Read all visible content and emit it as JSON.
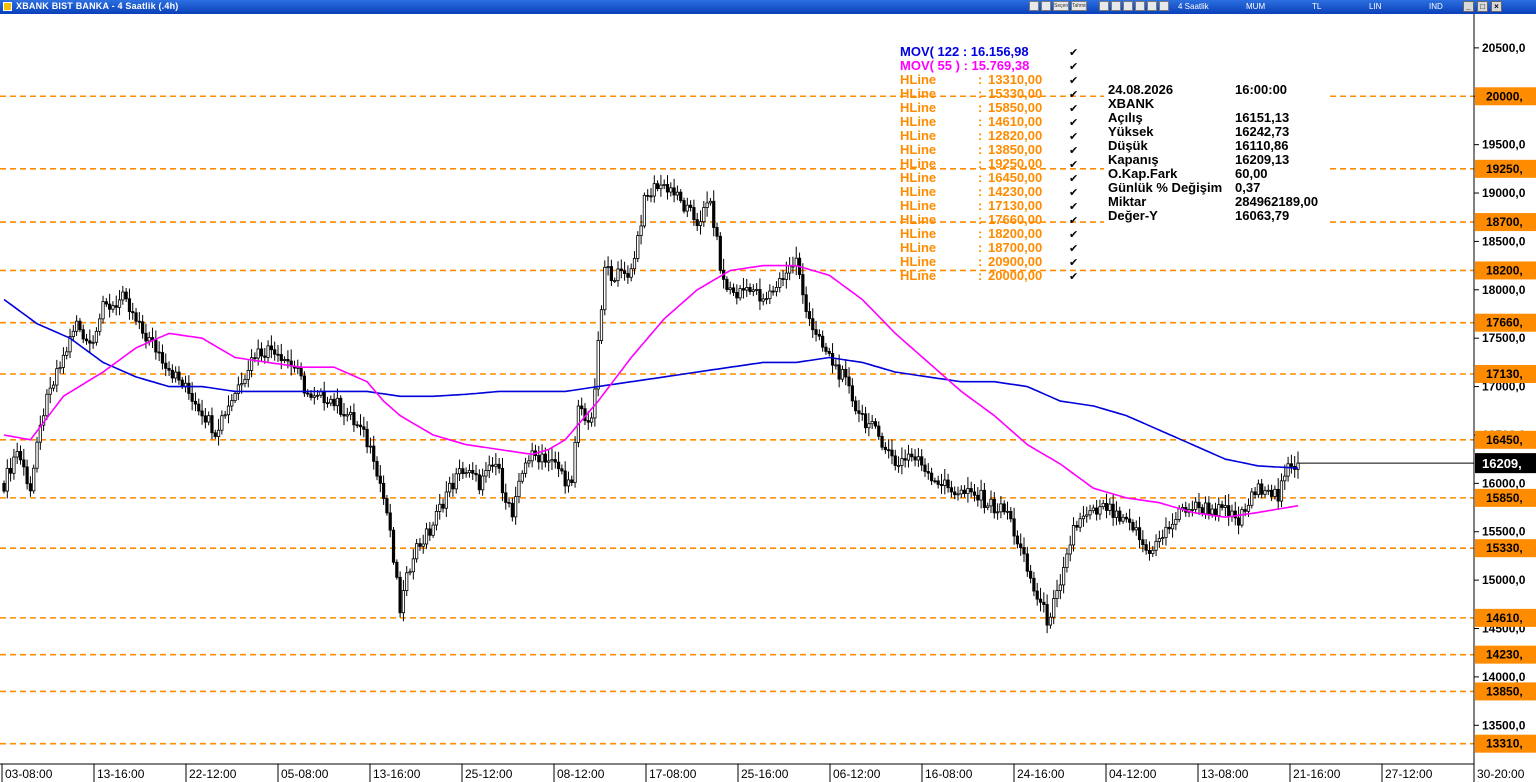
{
  "window": {
    "title": "XBANK BIST BANKA - 4 Saatlik (.4h)",
    "toolbar": [
      "4 Saatlik",
      "MUM",
      "TL",
      "LIN",
      "IND"
    ],
    "toolbar_small_labels": [
      "Seçenekler",
      "Tahmin"
    ],
    "window_buttons": [
      "_",
      "□",
      "×"
    ]
  },
  "legend": {
    "mov122": {
      "label": "MOV( 122 : 16.156,98",
      "color": "#0000e0"
    },
    "mov55": {
      "label": "MOV( 55 ) : 15.769,38",
      "color": "#ff00ff"
    },
    "hline_label": "HLine",
    "hline_values": [
      "13310,00",
      "15330,00",
      "15850,00",
      "14610,00",
      "12820,00",
      "13850,00",
      "19250,00",
      "16450,00",
      "14230,00",
      "17130,00",
      "17660,00",
      "18200,00",
      "18700,00",
      "20900,00",
      "20000,00"
    ],
    "check": "✔"
  },
  "info_box": {
    "date": "24.08.2026",
    "time": "16:00:00",
    "symbol": "XBANK",
    "rows": [
      {
        "label": "Açılış",
        "value": "16151,13"
      },
      {
        "label": "Yüksek",
        "value": "16242,73"
      },
      {
        "label": "Düşük",
        "value": "16110,86"
      },
      {
        "label": "Kapanış",
        "value": "16209,13"
      },
      {
        "label": "O.Kap.Fark",
        "value": "60,00"
      },
      {
        "label": "Günlük % Değişim",
        "value": "0,37"
      },
      {
        "label": "Miktar",
        "value": "284962189,00"
      },
      {
        "label": "Değer-Y",
        "value": "16063,79"
      }
    ]
  },
  "chart_data": {
    "type": "candlestick",
    "symbol": "XBANK",
    "ylim": [
      13100,
      20850
    ],
    "y_ticks": [
      "20500,0",
      "20000,",
      "19500,0",
      "19000,0",
      "18500,0",
      "18000,0",
      "17500,0",
      "17000,0",
      "16500,0",
      "16000,0",
      "15500,0",
      "15000,0",
      "14500,0",
      "14000,0",
      "13500,0"
    ],
    "y_tick_values": [
      20500,
      20000,
      19500,
      19000,
      18500,
      18000,
      17500,
      17000,
      16500,
      16000,
      15500,
      15000,
      14500,
      14000,
      13500
    ],
    "hlines": [
      {
        "value": 20000,
        "label": "20000,"
      },
      {
        "value": 19250,
        "label": "19250,"
      },
      {
        "value": 18700,
        "label": "18700,"
      },
      {
        "value": 18200,
        "label": "18200,"
      },
      {
        "value": 17660,
        "label": "17660,"
      },
      {
        "value": 17130,
        "label": "17130,"
      },
      {
        "value": 16450,
        "label": "16450,"
      },
      {
        "value": 15850,
        "label": "15850,"
      },
      {
        "value": 15330,
        "label": "15330,"
      },
      {
        "value": 14610,
        "label": "14610,"
      },
      {
        "value": 14230,
        "label": "14230,"
      },
      {
        "value": 13850,
        "label": "13850,"
      },
      {
        "value": 13310,
        "label": "13310,"
      }
    ],
    "last_price": {
      "value": 16209,
      "label": "16209,"
    },
    "x_tick_labels": [
      "03-08:00",
      "13-16:00",
      "22-12:00",
      "05-08:00",
      "13-16:00",
      "25-12:00",
      "08-12:00",
      "17-08:00",
      "25-16:00",
      "06-12:00",
      "16-08:00",
      "24-16:00",
      "04-12:00",
      "13-08:00",
      "21-16:00",
      "27-12:00",
      "30-20:00"
    ],
    "close_anchors": [
      [
        0,
        16000
      ],
      [
        4,
        16350
      ],
      [
        8,
        15950
      ],
      [
        12,
        16750
      ],
      [
        18,
        17300
      ],
      [
        22,
        17650
      ],
      [
        26,
        17450
      ],
      [
        30,
        17800
      ],
      [
        36,
        17900
      ],
      [
        41,
        17600
      ],
      [
        47,
        17350
      ],
      [
        52,
        17100
      ],
      [
        58,
        16850
      ],
      [
        64,
        16550
      ],
      [
        70,
        16950
      ],
      [
        76,
        17350
      ],
      [
        82,
        17400
      ],
      [
        88,
        17200
      ],
      [
        93,
        16850
      ],
      [
        98,
        16900
      ],
      [
        103,
        16750
      ],
      [
        108,
        16550
      ],
      [
        112,
        16300
      ],
      [
        116,
        15700
      ],
      [
        120,
        14700
      ],
      [
        124,
        15300
      ],
      [
        129,
        15500
      ],
      [
        134,
        15900
      ],
      [
        139,
        16150
      ],
      [
        144,
        16000
      ],
      [
        149,
        16200
      ],
      [
        154,
        15650
      ],
      [
        158,
        16250
      ],
      [
        163,
        16300
      ],
      [
        168,
        16150
      ],
      [
        172,
        15950
      ],
      [
        174,
        16800
      ],
      [
        178,
        16600
      ],
      [
        182,
        18200
      ],
      [
        186,
        18150
      ],
      [
        190,
        18200
      ],
      [
        194,
        18900
      ],
      [
        198,
        19100
      ],
      [
        202,
        19050
      ],
      [
        206,
        18850
      ],
      [
        210,
        18700
      ],
      [
        214,
        18900
      ],
      [
        218,
        18050
      ],
      [
        222,
        17950
      ],
      [
        226,
        18050
      ],
      [
        230,
        17850
      ],
      [
        236,
        18150
      ],
      [
        240,
        18300
      ],
      [
        242,
        17950
      ],
      [
        246,
        17500
      ],
      [
        250,
        17300
      ],
      [
        254,
        17100
      ],
      [
        258,
        16800
      ],
      [
        262,
        16600
      ],
      [
        266,
        16450
      ],
      [
        270,
        16200
      ],
      [
        274,
        16300
      ],
      [
        278,
        16200
      ],
      [
        282,
        16050
      ],
      [
        286,
        15950
      ],
      [
        290,
        15900
      ],
      [
        296,
        15850
      ],
      [
        300,
        15750
      ],
      [
        304,
        15700
      ],
      [
        308,
        15300
      ],
      [
        312,
        14900
      ],
      [
        316,
        14600
      ],
      [
        320,
        14900
      ],
      [
        324,
        15550
      ],
      [
        328,
        15650
      ],
      [
        334,
        15750
      ],
      [
        338,
        15600
      ],
      [
        342,
        15550
      ],
      [
        346,
        15300
      ],
      [
        350,
        15400
      ],
      [
        354,
        15600
      ],
      [
        358,
        15750
      ],
      [
        364,
        15750
      ],
      [
        370,
        15700
      ],
      [
        374,
        15600
      ],
      [
        378,
        15850
      ],
      [
        382,
        16000
      ],
      [
        386,
        15850
      ],
      [
        389,
        16150
      ],
      [
        392,
        16209
      ]
    ],
    "mov122": {
      "name": "MOV( 122",
      "last": 16156.98,
      "anchors": [
        [
          0,
          17900
        ],
        [
          10,
          17650
        ],
        [
          20,
          17500
        ],
        [
          30,
          17250
        ],
        [
          40,
          17100
        ],
        [
          50,
          17000
        ],
        [
          60,
          17000
        ],
        [
          70,
          16950
        ],
        [
          80,
          16950
        ],
        [
          90,
          16950
        ],
        [
          100,
          16950
        ],
        [
          110,
          16950
        ],
        [
          120,
          16900
        ],
        [
          130,
          16900
        ],
        [
          140,
          16920
        ],
        [
          150,
          16950
        ],
        [
          160,
          16950
        ],
        [
          170,
          16950
        ],
        [
          180,
          17000
        ],
        [
          190,
          17050
        ],
        [
          200,
          17100
        ],
        [
          210,
          17150
        ],
        [
          220,
          17200
        ],
        [
          230,
          17250
        ],
        [
          240,
          17250
        ],
        [
          250,
          17300
        ],
        [
          260,
          17250
        ],
        [
          270,
          17150
        ],
        [
          280,
          17100
        ],
        [
          290,
          17050
        ],
        [
          300,
          17050
        ],
        [
          310,
          17000
        ],
        [
          320,
          16850
        ],
        [
          330,
          16800
        ],
        [
          340,
          16700
        ],
        [
          350,
          16550
        ],
        [
          360,
          16400
        ],
        [
          370,
          16250
        ],
        [
          380,
          16180
        ],
        [
          392,
          16157
        ]
      ]
    },
    "mov55": {
      "name": "MOV( 55 )",
      "last": 15769.38,
      "anchors": [
        [
          0,
          16500
        ],
        [
          8,
          16450
        ],
        [
          18,
          16900
        ],
        [
          30,
          17150
        ],
        [
          40,
          17400
        ],
        [
          50,
          17550
        ],
        [
          60,
          17500
        ],
        [
          70,
          17300
        ],
        [
          80,
          17250
        ],
        [
          90,
          17200
        ],
        [
          100,
          17200
        ],
        [
          110,
          17050
        ],
        [
          115,
          16850
        ],
        [
          120,
          16700
        ],
        [
          130,
          16500
        ],
        [
          140,
          16400
        ],
        [
          150,
          16350
        ],
        [
          160,
          16300
        ],
        [
          165,
          16350
        ],
        [
          170,
          16450
        ],
        [
          180,
          16850
        ],
        [
          190,
          17300
        ],
        [
          200,
          17700
        ],
        [
          210,
          18000
        ],
        [
          220,
          18200
        ],
        [
          230,
          18250
        ],
        [
          240,
          18250
        ],
        [
          250,
          18150
        ],
        [
          260,
          17900
        ],
        [
          270,
          17550
        ],
        [
          280,
          17250
        ],
        [
          290,
          16950
        ],
        [
          300,
          16700
        ],
        [
          310,
          16400
        ],
        [
          320,
          16200
        ],
        [
          330,
          15950
        ],
        [
          340,
          15850
        ],
        [
          350,
          15800
        ],
        [
          360,
          15700
        ],
        [
          370,
          15650
        ],
        [
          380,
          15700
        ],
        [
          392,
          15769
        ]
      ]
    }
  }
}
